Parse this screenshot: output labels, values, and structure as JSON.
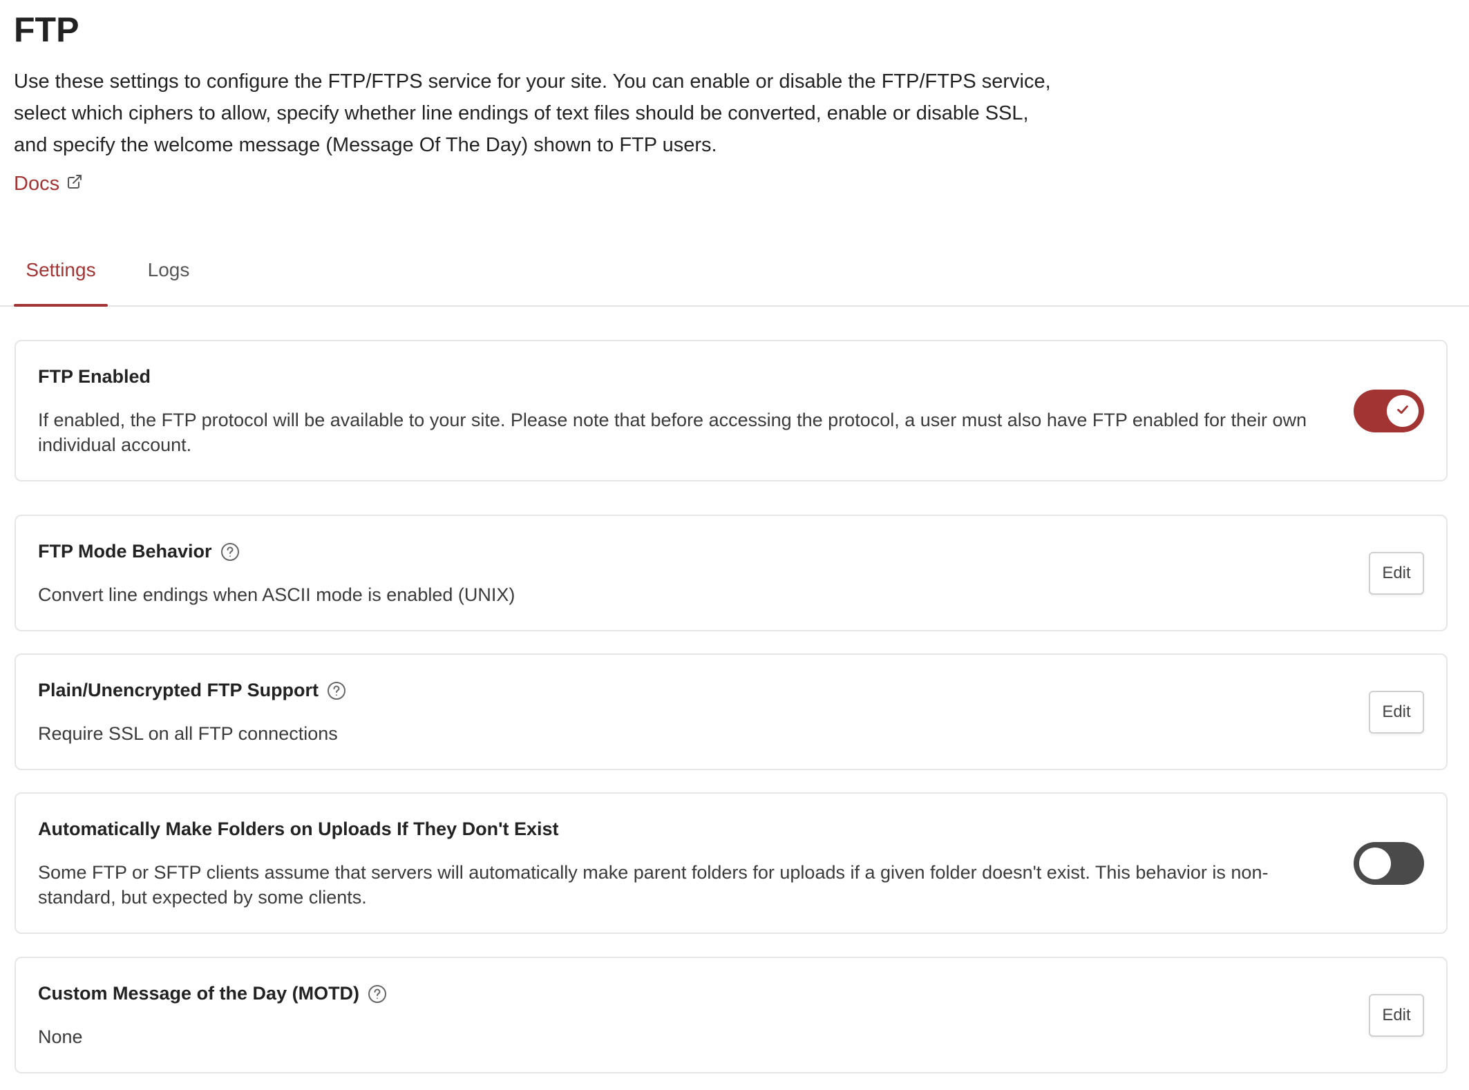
{
  "page": {
    "title": "FTP",
    "description": "Use these settings to configure the FTP/FTPS service for your site. You can enable or disable the FTP/FTPS service, select which ciphers to allow, specify whether line endings of text files should be converted, enable or disable SSL, and specify the welcome message (Message Of The Day) shown to FTP users.",
    "docs_label": "Docs",
    "accent_color": "#a33434"
  },
  "tabs": [
    {
      "label": "Settings",
      "active": true
    },
    {
      "label": "Logs",
      "active": false
    }
  ],
  "settings": [
    {
      "title": "FTP Enabled",
      "text": "If enabled, the FTP protocol will be available to your site. Please note that before accessing the protocol, a user must also have FTP enabled for their own individual account.",
      "control": "toggle",
      "state": "on"
    },
    {
      "title": "FTP Mode Behavior",
      "text": "Convert line endings when ASCII mode is enabled (UNIX)",
      "control": "edit",
      "edit_label": "Edit",
      "has_help": true
    },
    {
      "title": "Plain/Unencrypted FTP Support",
      "text": "Require SSL on all FTP connections",
      "control": "edit",
      "edit_label": "Edit",
      "has_help": true
    },
    {
      "title": "Automatically Make Folders on Uploads If They Don't Exist",
      "text": "Some FTP or SFTP clients assume that servers will automatically make parent folders for uploads if a given folder doesn't exist. This behavior is non-standard, but expected by some clients.",
      "control": "toggle",
      "state": "off"
    },
    {
      "title": "Custom Message of the Day (MOTD)",
      "text": "None",
      "control": "edit",
      "edit_label": "Edit",
      "has_help": true
    }
  ]
}
